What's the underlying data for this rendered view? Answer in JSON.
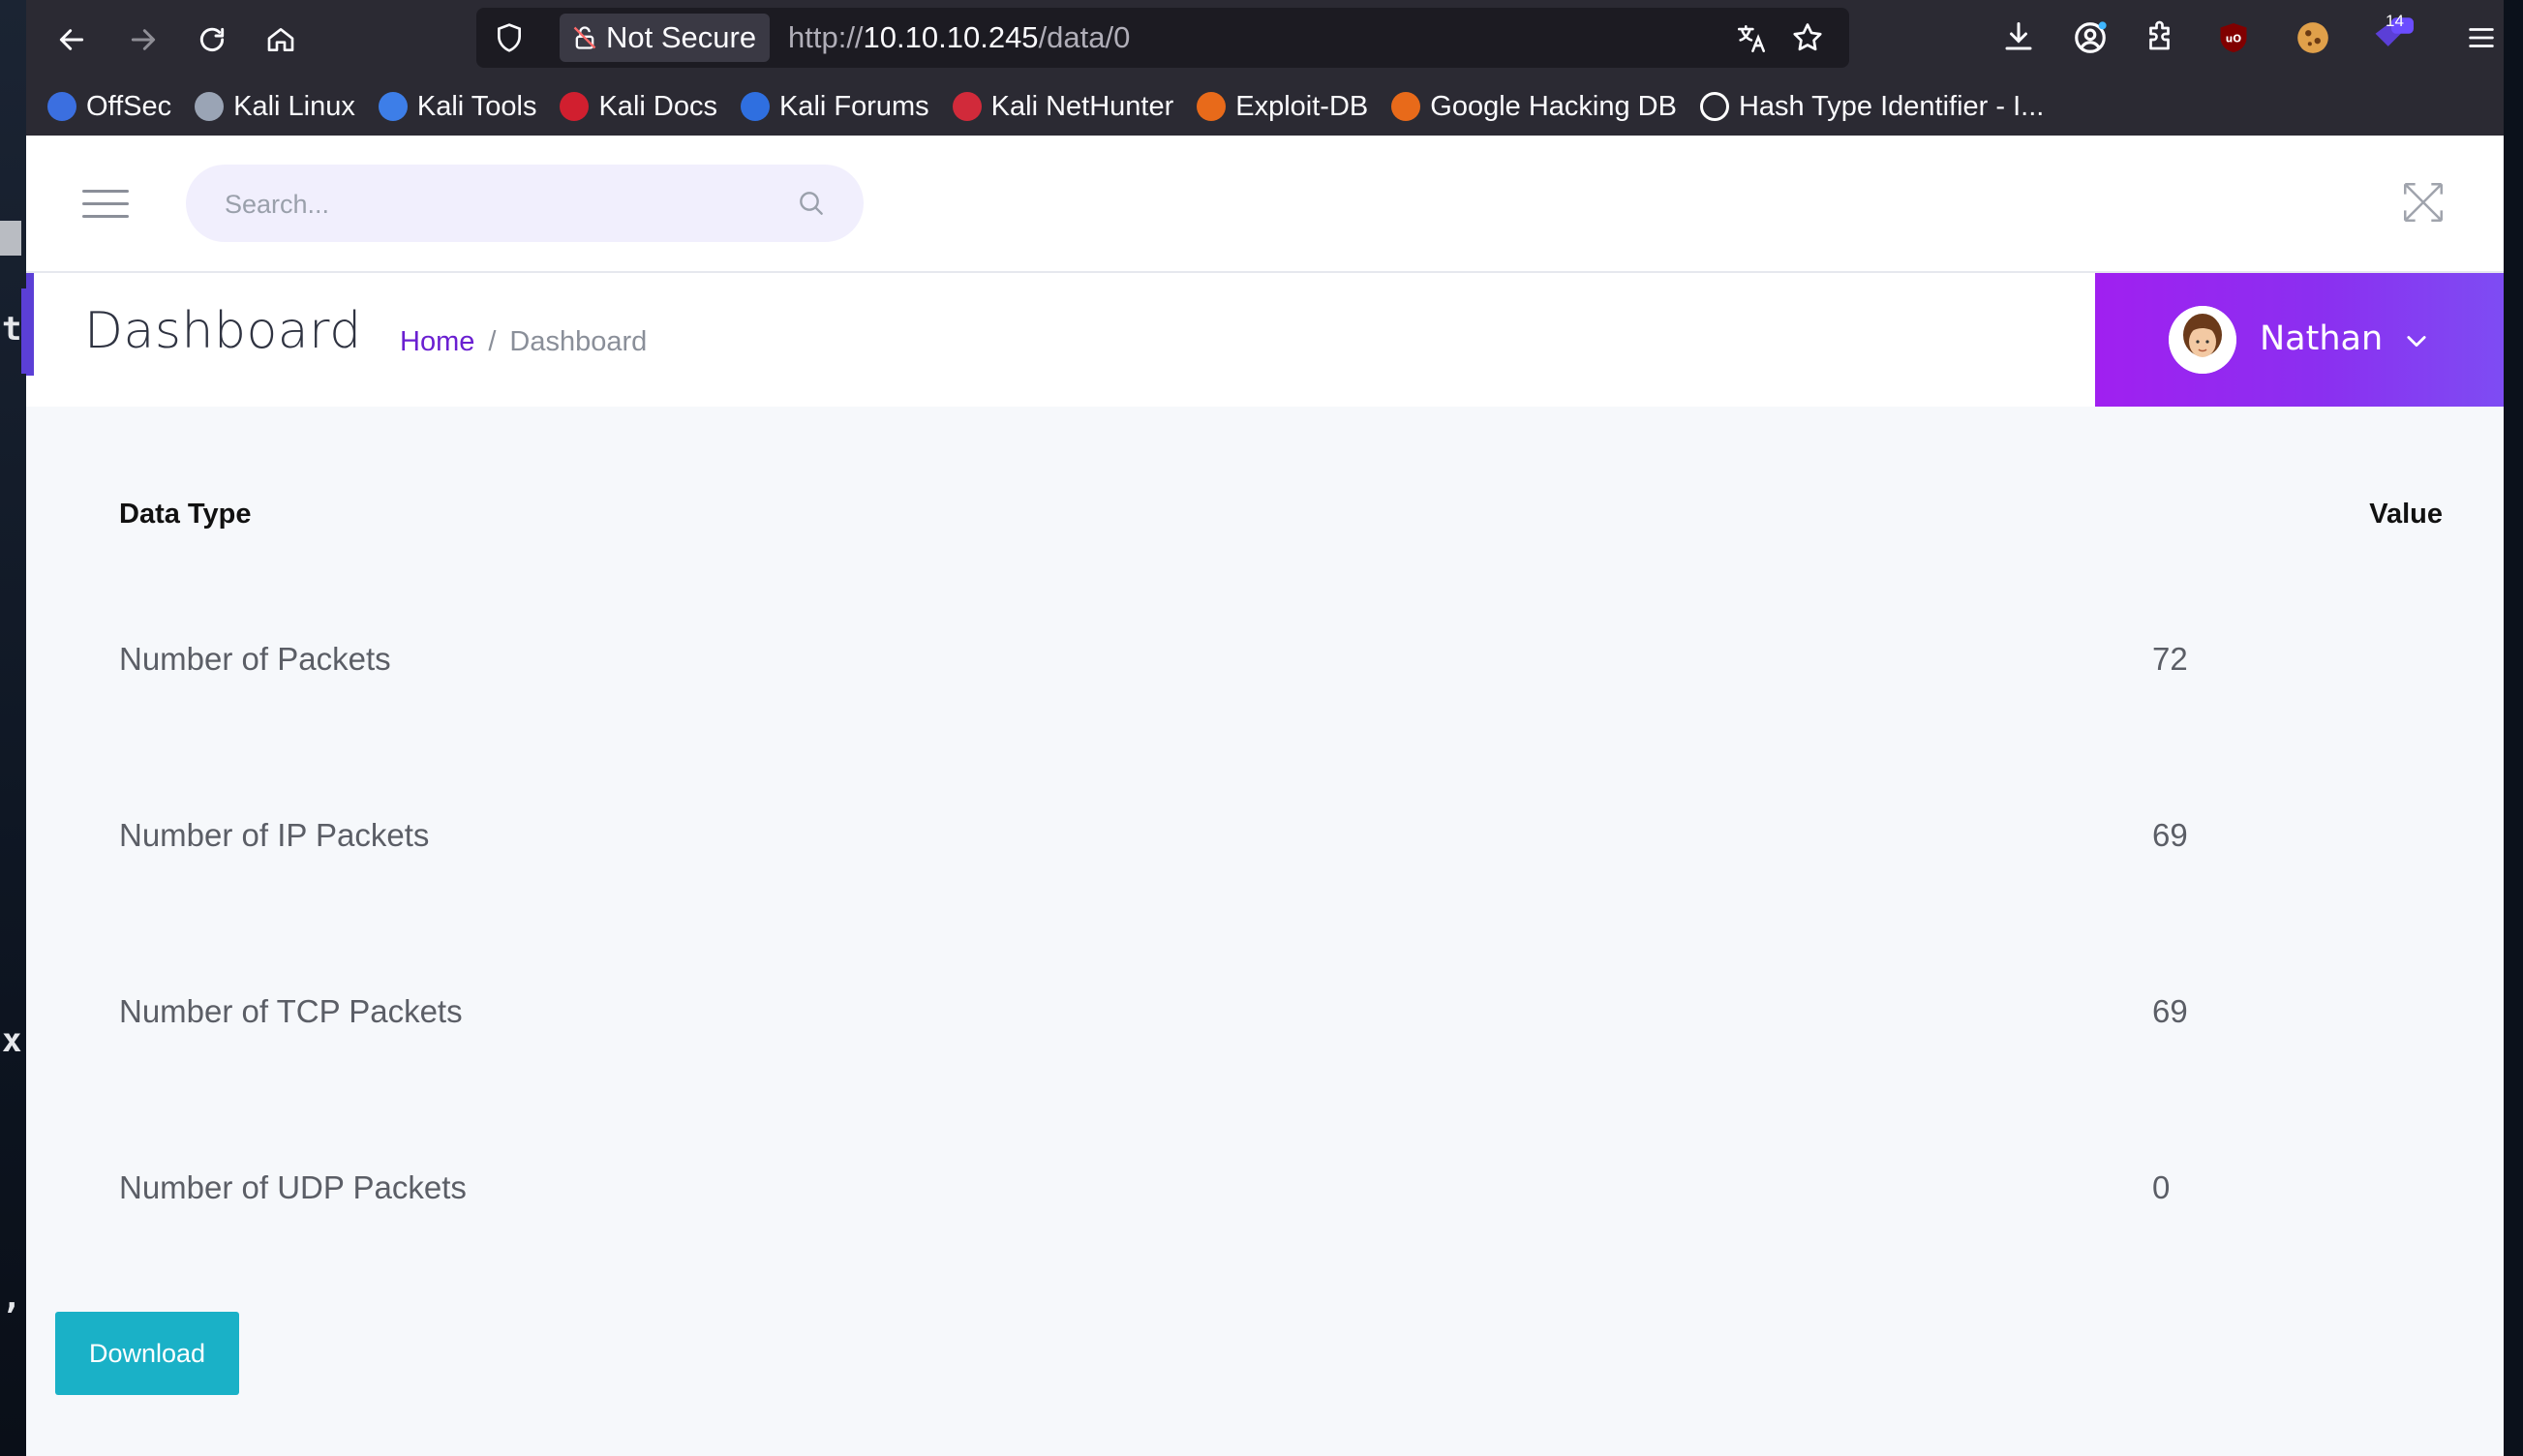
{
  "browser": {
    "security_label": "Not Secure",
    "url_scheme": "http://",
    "url_host": "10.10.10.245",
    "url_path": "/data/0",
    "notification_count": "14"
  },
  "bookmarks": [
    {
      "label": "OffSec",
      "color": "#3b6fe0"
    },
    {
      "label": "Kali Linux",
      "color": "#9aa4b5"
    },
    {
      "label": "Kali Tools",
      "color": "#3d7ee8"
    },
    {
      "label": "Kali Docs",
      "color": "#d11f2f"
    },
    {
      "label": "Kali Forums",
      "color": "#2f6fe0"
    },
    {
      "label": "Kali NetHunter",
      "color": "#d12a3a"
    },
    {
      "label": "Exploit-DB",
      "color": "#e86a1a"
    },
    {
      "label": "Google Hacking DB",
      "color": "#e86a1a"
    },
    {
      "label": "Hash Type Identifier - I...",
      "color": "#ffffff"
    }
  ],
  "app": {
    "search_placeholder": "Search...",
    "page_title": "Dashboard",
    "breadcrumb_home": "Home",
    "breadcrumb_sep": "/",
    "breadcrumb_current": "Dashboard",
    "user_name": "Nathan",
    "accent_color": "#5b3fd6",
    "user_gradient": "#a020f0"
  },
  "table": {
    "headers": {
      "type": "Data Type",
      "value": "Value"
    },
    "rows": [
      {
        "type": "Number of Packets",
        "value": "72"
      },
      {
        "type": "Number of IP Packets",
        "value": "69"
      },
      {
        "type": "Number of TCP Packets",
        "value": "69"
      },
      {
        "type": "Number of UDP Packets",
        "value": "0"
      }
    ]
  },
  "download_label": "Download",
  "desktop_chars": [
    "t",
    "x",
    ","
  ]
}
